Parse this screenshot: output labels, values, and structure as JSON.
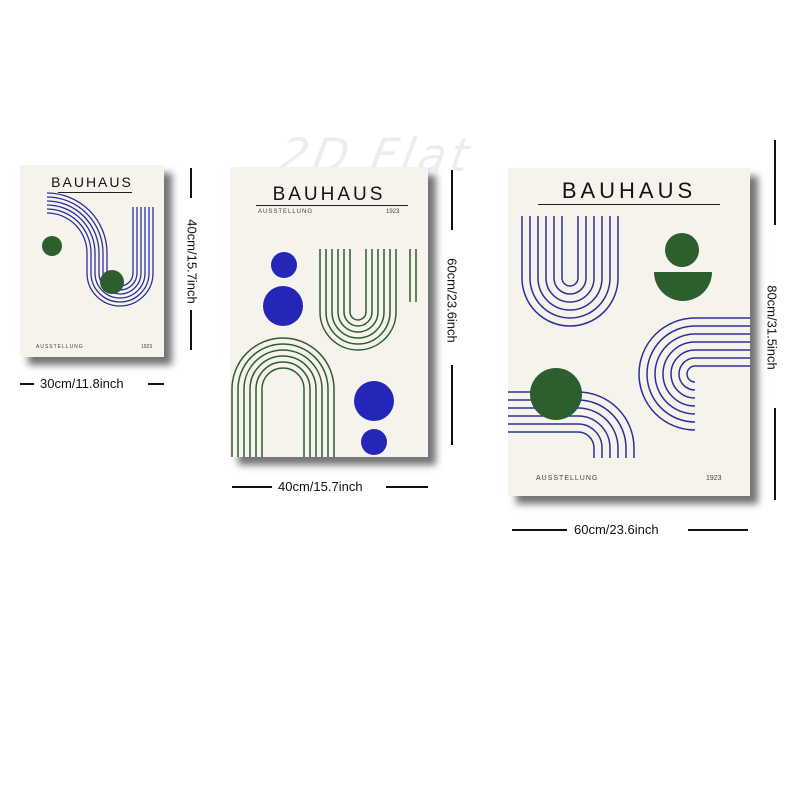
{
  "watermark": "2D Flat",
  "colors": {
    "blue": "#2b2f9c",
    "green": "#2d5e2d",
    "paper": "#f6f3ec",
    "ink": "#141414"
  },
  "posters": [
    {
      "title": "BAUHAUS",
      "subtitle": "AUSSTELLUNG",
      "year": "1923",
      "width_label": "30cm/11.8inch",
      "height_label": "40cm/15.7inch"
    },
    {
      "title": "BAUHAUS",
      "subtitle": "AUSSTELLUNG",
      "year": "1923",
      "width_label": "40cm/15.7inch",
      "height_label": "60cm/23.6inch"
    },
    {
      "title": "BAUHAUS",
      "subtitle": "AUSSTELLUNG",
      "year": "1923",
      "width_label": "60cm/23.6inch",
      "height_label": "80cm/31.5inch"
    }
  ]
}
